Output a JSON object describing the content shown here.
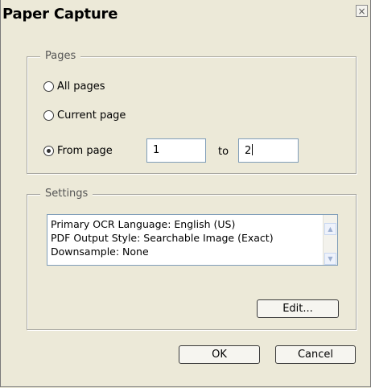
{
  "window": {
    "title": "Paper Capture",
    "close_symbol": "×"
  },
  "pages": {
    "legend": "Pages",
    "all_pages": "All pages",
    "current_page": "Current page",
    "from_page": "From page",
    "from_value": "1",
    "to_label": "to",
    "to_value": "2",
    "selected": "from_page"
  },
  "settings": {
    "legend": "Settings",
    "items": [
      "Primary OCR Language: English (US)",
      "PDF Output Style: Searchable Image (Exact)",
      "Downsample: None"
    ],
    "scroll_up": "▲",
    "scroll_down": "▼",
    "edit_label": "Edit..."
  },
  "buttons": {
    "ok": "OK",
    "cancel": "Cancel"
  }
}
